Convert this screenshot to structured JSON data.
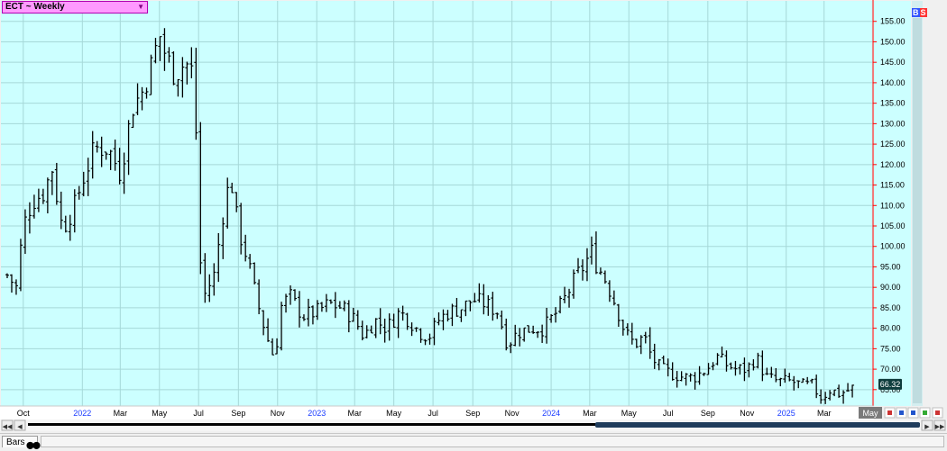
{
  "symbol_selector": {
    "label": "ECT ~ Weekly"
  },
  "badge": {
    "b": "B",
    "s": "S"
  },
  "bottom_tab": {
    "label": "Bars"
  },
  "last_price_label": "66.32",
  "current_month_label": "May",
  "colors": {
    "plot_bg": "#ccffff",
    "grid": "#a6d8d8",
    "bar": "#000000",
    "axis_line": "#ff0000",
    "year_label": "#1a3cff",
    "price_tag_bg": "#0f3d3d"
  },
  "chart_data": {
    "type": "ohlc",
    "ylim": [
      61,
      160
    ],
    "y_ticks": [
      "65.00",
      "70.00",
      "75.00",
      "80.00",
      "85.00",
      "90.00",
      "95.00",
      "100.00",
      "105.00",
      "110.00",
      "115.00",
      "120.00",
      "125.00",
      "130.00",
      "135.00",
      "140.00",
      "145.00",
      "150.00",
      "155.00"
    ],
    "x_tick_labels": [
      {
        "label": "Oct",
        "year": false,
        "date": "2021-10-01"
      },
      {
        "label": "2022",
        "year": true,
        "date": "2022-01-01"
      },
      {
        "label": "Mar",
        "year": false,
        "date": "2022-03-01"
      },
      {
        "label": "May",
        "year": false,
        "date": "2022-05-01"
      },
      {
        "label": "Jul",
        "year": false,
        "date": "2022-07-01"
      },
      {
        "label": "Sep",
        "year": false,
        "date": "2022-09-01"
      },
      {
        "label": "Nov",
        "year": false,
        "date": "2022-11-01"
      },
      {
        "label": "2023",
        "year": true,
        "date": "2023-01-01"
      },
      {
        "label": "Mar",
        "year": false,
        "date": "2023-03-01"
      },
      {
        "label": "May",
        "year": false,
        "date": "2023-05-01"
      },
      {
        "label": "Jul",
        "year": false,
        "date": "2023-07-01"
      },
      {
        "label": "Sep",
        "year": false,
        "date": "2023-09-01"
      },
      {
        "label": "Nov",
        "year": false,
        "date": "2023-11-01"
      },
      {
        "label": "2024",
        "year": true,
        "date": "2024-01-01"
      },
      {
        "label": "Mar",
        "year": false,
        "date": "2024-03-01"
      },
      {
        "label": "May",
        "year": false,
        "date": "2024-05-01"
      },
      {
        "label": "Jul",
        "year": false,
        "date": "2024-07-01"
      },
      {
        "label": "Sep",
        "year": false,
        "date": "2024-09-01"
      },
      {
        "label": "Nov",
        "year": false,
        "date": "2024-11-01"
      },
      {
        "label": "2025",
        "year": true,
        "date": "2025-01-01"
      },
      {
        "label": "Mar",
        "year": false,
        "date": "2025-03-01"
      }
    ],
    "x_range": [
      "2021-09-06",
      "2025-05-05"
    ],
    "weekly_close_points": [
      [
        "2021-09-06",
        93
      ],
      [
        "2021-09-20",
        90
      ],
      [
        "2021-10-01",
        105
      ],
      [
        "2021-10-15",
        111
      ],
      [
        "2021-11-01",
        113
      ],
      [
        "2021-11-15",
        119
      ],
      [
        "2021-12-01",
        104
      ],
      [
        "2021-12-20",
        110
      ],
      [
        "2022-01-01",
        116
      ],
      [
        "2022-01-20",
        124
      ],
      [
        "2022-02-10",
        124
      ],
      [
        "2022-03-01",
        118
      ],
      [
        "2022-03-20",
        134
      ],
      [
        "2022-04-05",
        138
      ],
      [
        "2022-04-20",
        145
      ],
      [
        "2022-05-01",
        152
      ],
      [
        "2022-05-10",
        147
      ],
      [
        "2022-05-25",
        142
      ],
      [
        "2022-06-10",
        145
      ],
      [
        "2022-06-25",
        142
      ],
      [
        "2022-07-01",
        100
      ],
      [
        "2022-07-10",
        88
      ],
      [
        "2022-07-25",
        93
      ],
      [
        "2022-08-10",
        110
      ],
      [
        "2022-08-20",
        117
      ],
      [
        "2022-09-01",
        104
      ],
      [
        "2022-09-15",
        97
      ],
      [
        "2022-10-01",
        86
      ],
      [
        "2022-10-15",
        78
      ],
      [
        "2022-10-28",
        72
      ],
      [
        "2022-11-05",
        85
      ],
      [
        "2022-11-20",
        88
      ],
      [
        "2022-12-10",
        83
      ],
      [
        "2023-01-01",
        84
      ],
      [
        "2023-01-20",
        86
      ],
      [
        "2023-02-10",
        85
      ],
      [
        "2023-03-01",
        82
      ],
      [
        "2023-03-15",
        78
      ],
      [
        "2023-04-01",
        82
      ],
      [
        "2023-04-20",
        80
      ],
      [
        "2023-05-10",
        84
      ],
      [
        "2023-05-25",
        82
      ],
      [
        "2023-06-10",
        79
      ],
      [
        "2023-06-25",
        78
      ],
      [
        "2023-07-10",
        82
      ],
      [
        "2023-07-25",
        84
      ],
      [
        "2023-08-15",
        85
      ],
      [
        "2023-09-01",
        87
      ],
      [
        "2023-09-20",
        86
      ],
      [
        "2023-10-10",
        84
      ],
      [
        "2023-10-25",
        76
      ],
      [
        "2023-11-10",
        79
      ],
      [
        "2023-12-01",
        80
      ],
      [
        "2023-12-20",
        80
      ],
      [
        "2024-01-10",
        84
      ],
      [
        "2024-01-25",
        88
      ],
      [
        "2024-02-10",
        93
      ],
      [
        "2024-02-25",
        96
      ],
      [
        "2024-03-01",
        100
      ],
      [
        "2024-03-10",
        96
      ],
      [
        "2024-03-25",
        92
      ],
      [
        "2024-04-10",
        86
      ],
      [
        "2024-04-25",
        79
      ],
      [
        "2024-05-10",
        76
      ],
      [
        "2024-05-25",
        78
      ],
      [
        "2024-06-05",
        73
      ],
      [
        "2024-06-20",
        70
      ],
      [
        "2024-07-05",
        69
      ],
      [
        "2024-07-25",
        68
      ],
      [
        "2024-08-10",
        68
      ],
      [
        "2024-08-30",
        70
      ],
      [
        "2024-09-15",
        73
      ],
      [
        "2024-10-01",
        71
      ],
      [
        "2024-10-15",
        70
      ],
      [
        "2024-11-01",
        70
      ],
      [
        "2024-11-15",
        73
      ],
      [
        "2024-12-01",
        68
      ],
      [
        "2024-12-20",
        67
      ],
      [
        "2025-01-10",
        67
      ],
      [
        "2025-01-25",
        66
      ],
      [
        "2025-02-10",
        66
      ],
      [
        "2025-02-25",
        63
      ],
      [
        "2025-03-10",
        65
      ],
      [
        "2025-03-25",
        64
      ],
      [
        "2025-04-10",
        65
      ],
      [
        "2025-04-20",
        66
      ]
    ],
    "last_value": 66.32
  }
}
